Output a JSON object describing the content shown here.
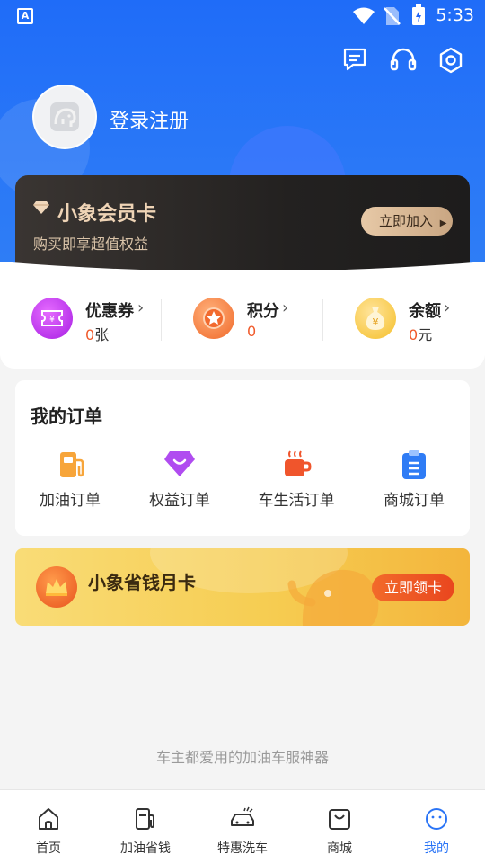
{
  "status_bar": {
    "app_badge": "A",
    "time": "5:33"
  },
  "header": {
    "login_label": "登录注册"
  },
  "member_card": {
    "title": "小象会员卡",
    "subtitle": "购买即享超值权益",
    "join_label": "立即加入"
  },
  "assets": [
    {
      "name": "优惠券",
      "value": "0",
      "unit": "张"
    },
    {
      "name": "积分",
      "value": "0",
      "unit": ""
    },
    {
      "name": "余额",
      "value": "0",
      "unit": "元"
    }
  ],
  "orders": {
    "title": "我的订单",
    "items": [
      {
        "label": "加油订单",
        "icon": "fuel-pump-icon"
      },
      {
        "label": "权益订单",
        "icon": "diamond-icon"
      },
      {
        "label": "车生活订单",
        "icon": "coffee-cup-icon"
      },
      {
        "label": "商城订单",
        "icon": "clipboard-icon"
      }
    ]
  },
  "save_card": {
    "title": "小象省钱月卡",
    "button_label": "立即领卡"
  },
  "slogan": "车主都爱用的加油车服神器",
  "tabbar": {
    "items": [
      {
        "label": "首页",
        "icon": "home-icon"
      },
      {
        "label": "加油省钱",
        "icon": "fuel-pump-icon"
      },
      {
        "label": "特惠洗车",
        "icon": "car-wash-icon"
      },
      {
        "label": "商城",
        "icon": "shopping-bag-icon"
      },
      {
        "label": "我的",
        "icon": "smile-icon"
      }
    ],
    "active_index": 4
  },
  "colors": {
    "primary": "#2a74f6",
    "accent": "#f05a2b",
    "gold": "#efd4b6"
  }
}
